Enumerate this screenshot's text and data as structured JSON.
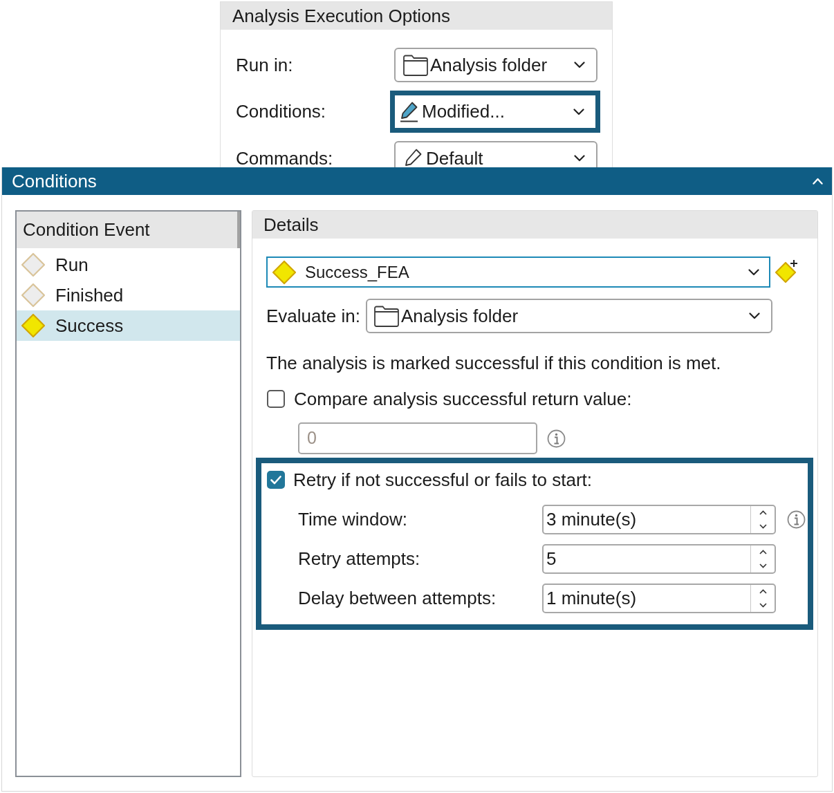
{
  "execution_options": {
    "title": "Analysis Execution Options",
    "rows": [
      {
        "label": "Run in:",
        "value": "Analysis folder",
        "kind": "folder",
        "highlighted": false
      },
      {
        "label": "Conditions:",
        "value": "Modified...",
        "kind": "marker",
        "highlighted": true
      },
      {
        "label": "Commands:",
        "value": "Default",
        "kind": "pencil",
        "highlighted": false
      }
    ]
  },
  "conditions": {
    "title": "Conditions",
    "expanded": true,
    "event_list": {
      "header": "Condition Event",
      "items": [
        {
          "label": "Run",
          "has_condition": false,
          "selected": false
        },
        {
          "label": "Finished",
          "has_condition": false,
          "selected": false
        },
        {
          "label": "Success",
          "has_condition": true,
          "selected": true
        }
      ]
    },
    "details": {
      "title": "Details",
      "condition": {
        "value": "Success_FEA",
        "focused": true
      },
      "evaluate_in": {
        "label": "Evaluate in:",
        "value": "Analysis folder"
      },
      "description": "The analysis is marked successful if this condition is met.",
      "compare": {
        "label": "Compare analysis successful return value:",
        "checked": false,
        "value": "0",
        "disabled": true
      },
      "retry": {
        "label": "Retry if not successful or fails to start:",
        "checked": true,
        "highlighted": true,
        "fields": [
          {
            "label": "Time window:",
            "value": "3 minute(s)",
            "info": true
          },
          {
            "label": "Retry attempts:",
            "value": "5",
            "info": false
          },
          {
            "label": "Delay between attempts:",
            "value": "1 minute(s)",
            "info": false
          }
        ]
      }
    }
  }
}
